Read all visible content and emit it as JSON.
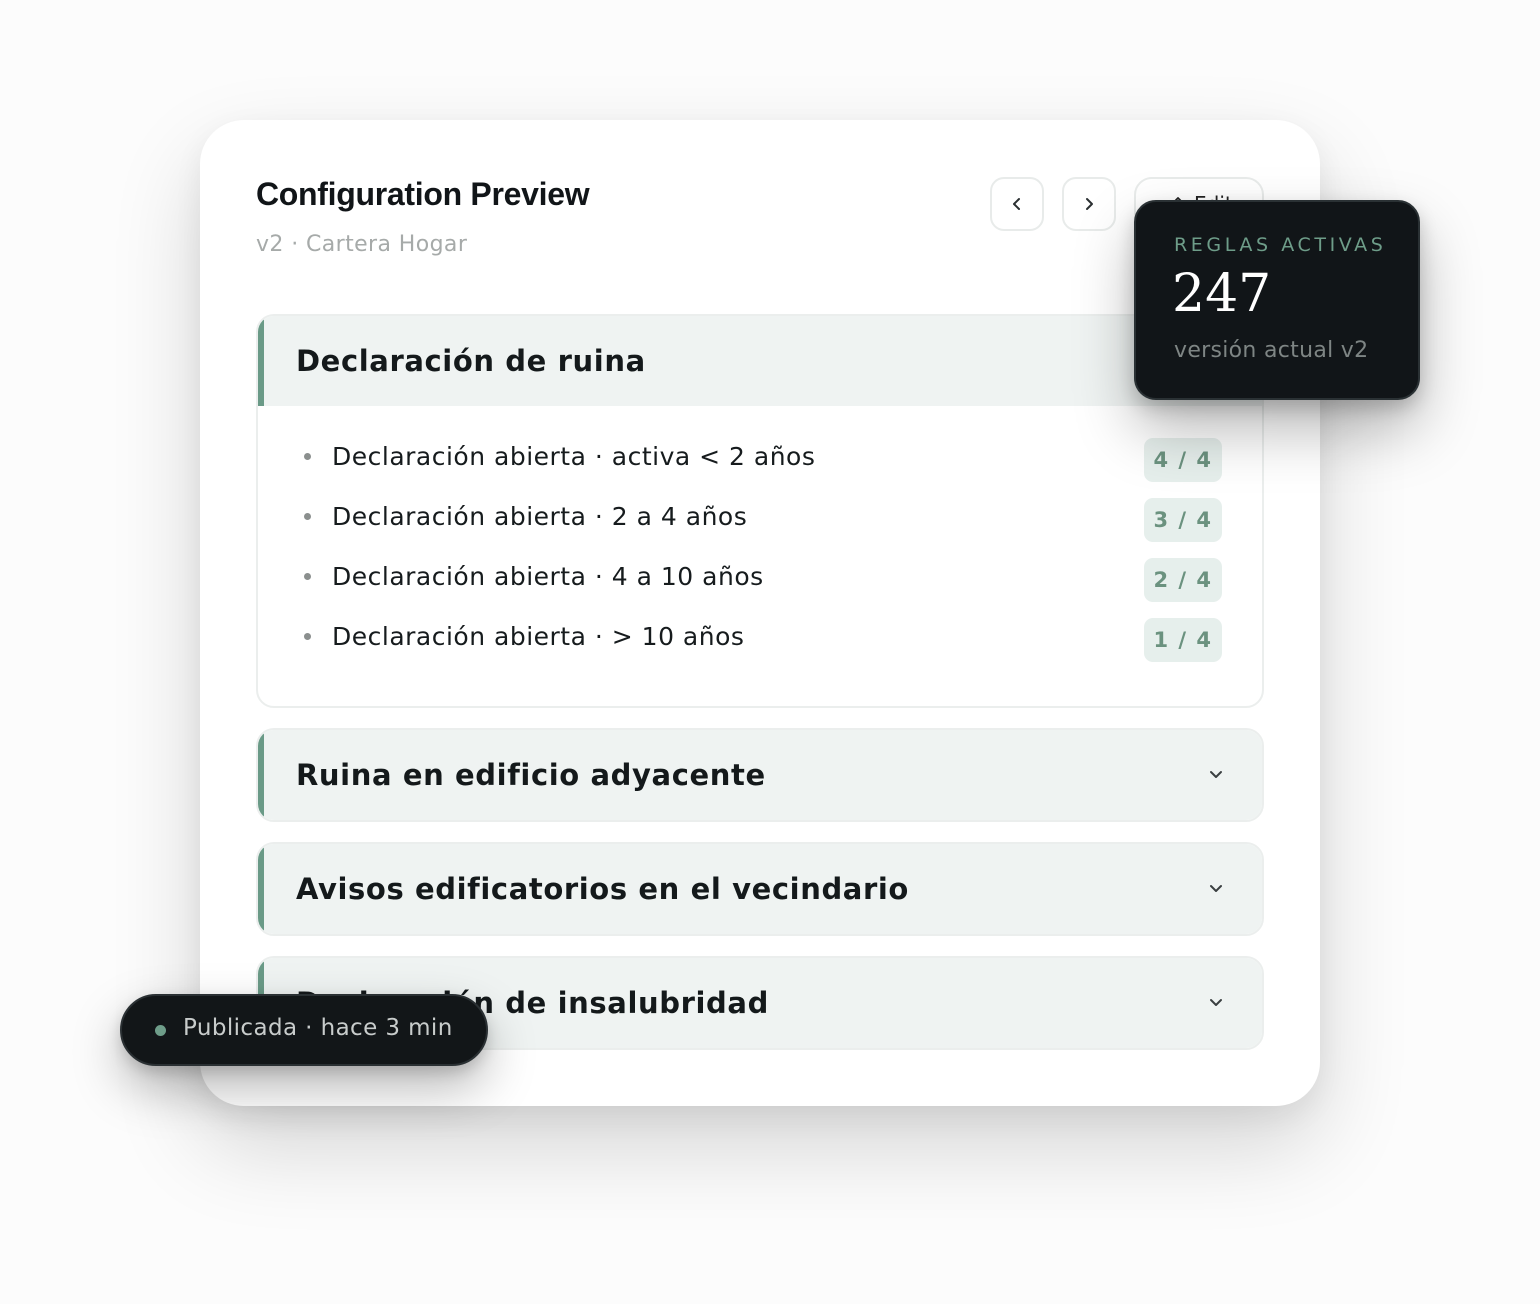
{
  "header": {
    "title": "Configuration Preview",
    "subtitle": "v2 · Cartera Hogar",
    "edit_label": "Edit"
  },
  "sections": [
    {
      "title": "Declaración de ruina",
      "expanded": true,
      "rules": [
        {
          "label": "Declaración abierta · activa < 2 años",
          "score": "4 / 4"
        },
        {
          "label": "Declaración abierta · 2 a 4 años",
          "score": "3 / 4"
        },
        {
          "label": "Declaración abierta · 4 a 10 años",
          "score": "2 / 4"
        },
        {
          "label": "Declaración abierta · > 10 años",
          "score": "1 / 4"
        }
      ]
    },
    {
      "title": "Ruina en edificio adyacente",
      "expanded": false
    },
    {
      "title": "Avisos edificatorios en el vecindario",
      "expanded": false
    },
    {
      "title": "Declaración de insalubridad",
      "expanded": false
    }
  ],
  "stat_card": {
    "label": "REGLAS ACTIVAS",
    "value": "247",
    "caption": "versión actual v2"
  },
  "toast": {
    "text": "Publicada · hace 3 min"
  },
  "colors": {
    "accent": "#6a9a87",
    "section_bg": "#eff3f2",
    "badge_bg": "#e6efec",
    "dark_surface": "#111518"
  },
  "icons": {
    "prev": "chevron-left-icon",
    "next": "chevron-right-icon",
    "edit": "pencil-icon",
    "collapse": "chevron-down-icon",
    "status": "status-dot-icon"
  }
}
